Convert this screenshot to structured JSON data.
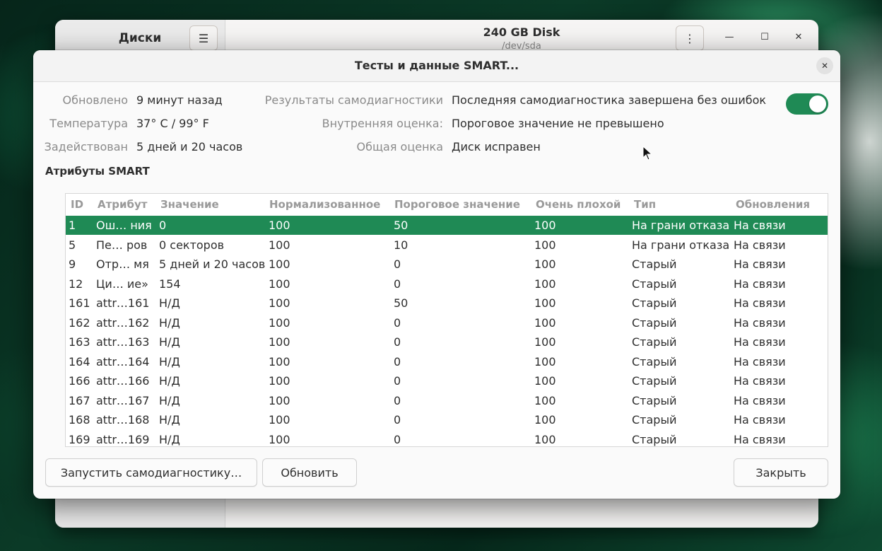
{
  "bg_window": {
    "sidebar_title": "Диски",
    "disk_title": "240 GB Disk",
    "disk_subtitle": "/dev/sda"
  },
  "dialog": {
    "title": "Тесты и данные SMART..."
  },
  "info": {
    "updated_label": "Обновлено",
    "updated_value": "9 минут назад",
    "temperature_label": "Температура",
    "temperature_value": "37° C / 99° F",
    "powered_label": "Задействован",
    "powered_value": "5 дней и 20 часов",
    "selftest_label": "Результаты самодиагностики",
    "selftest_value": "Последняя самодиагностика завершена без ошибок",
    "internal_label": "Внутренняя оценка:",
    "internal_value": "Пороговое значение не превышено",
    "overall_label": "Общая оценка",
    "overall_value": "Диск исправен"
  },
  "smart_section_title": "Атрибуты SMART",
  "table": {
    "headers": [
      "ID",
      "Атрибут",
      "Значение",
      "Нормализованное",
      "Пороговое значение",
      "Очень плохой",
      "Тип",
      "Обновления"
    ],
    "rows": [
      {
        "id": "1",
        "attr": "Ош… ния",
        "value": "0",
        "norm": "100",
        "thresh": "50",
        "worst": "100",
        "type": "На грани отказа",
        "updates": "На связи"
      },
      {
        "id": "5",
        "attr": "Пе… ров",
        "value": "0 секторов",
        "norm": "100",
        "thresh": "10",
        "worst": "100",
        "type": "На грани отказа",
        "updates": "На связи"
      },
      {
        "id": "9",
        "attr": "Отр… мя",
        "value": "5 дней и 20 часов",
        "norm": "100",
        "thresh": "0",
        "worst": "100",
        "type": "Старый",
        "updates": "На связи"
      },
      {
        "id": "12",
        "attr": "Ци… ие»",
        "value": "154",
        "norm": "100",
        "thresh": "0",
        "worst": "100",
        "type": "Старый",
        "updates": "На связи"
      },
      {
        "id": "161",
        "attr": "attr…161",
        "value": "Н/Д",
        "norm": "100",
        "thresh": "50",
        "worst": "100",
        "type": "Старый",
        "updates": "На связи"
      },
      {
        "id": "162",
        "attr": "attr…162",
        "value": "Н/Д",
        "norm": "100",
        "thresh": "0",
        "worst": "100",
        "type": "Старый",
        "updates": "На связи"
      },
      {
        "id": "163",
        "attr": "attr…163",
        "value": "Н/Д",
        "norm": "100",
        "thresh": "0",
        "worst": "100",
        "type": "Старый",
        "updates": "На связи"
      },
      {
        "id": "164",
        "attr": "attr…164",
        "value": "Н/Д",
        "norm": "100",
        "thresh": "0",
        "worst": "100",
        "type": "Старый",
        "updates": "На связи"
      },
      {
        "id": "166",
        "attr": "attr…166",
        "value": "Н/Д",
        "norm": "100",
        "thresh": "0",
        "worst": "100",
        "type": "Старый",
        "updates": "На связи"
      },
      {
        "id": "167",
        "attr": "attr…167",
        "value": "Н/Д",
        "norm": "100",
        "thresh": "0",
        "worst": "100",
        "type": "Старый",
        "updates": "На связи"
      },
      {
        "id": "168",
        "attr": "attr…168",
        "value": "Н/Д",
        "norm": "100",
        "thresh": "0",
        "worst": "100",
        "type": "Старый",
        "updates": "На связи"
      },
      {
        "id": "169",
        "attr": "attr…169",
        "value": "Н/Д",
        "norm": "100",
        "thresh": "0",
        "worst": "100",
        "type": "Старый",
        "updates": "На связи"
      }
    ]
  },
  "buttons": {
    "selftest": "Запустить самодиагностику…",
    "refresh": "Обновить",
    "close": "Закрыть"
  },
  "colors": {
    "accent": "#1f8a55"
  }
}
